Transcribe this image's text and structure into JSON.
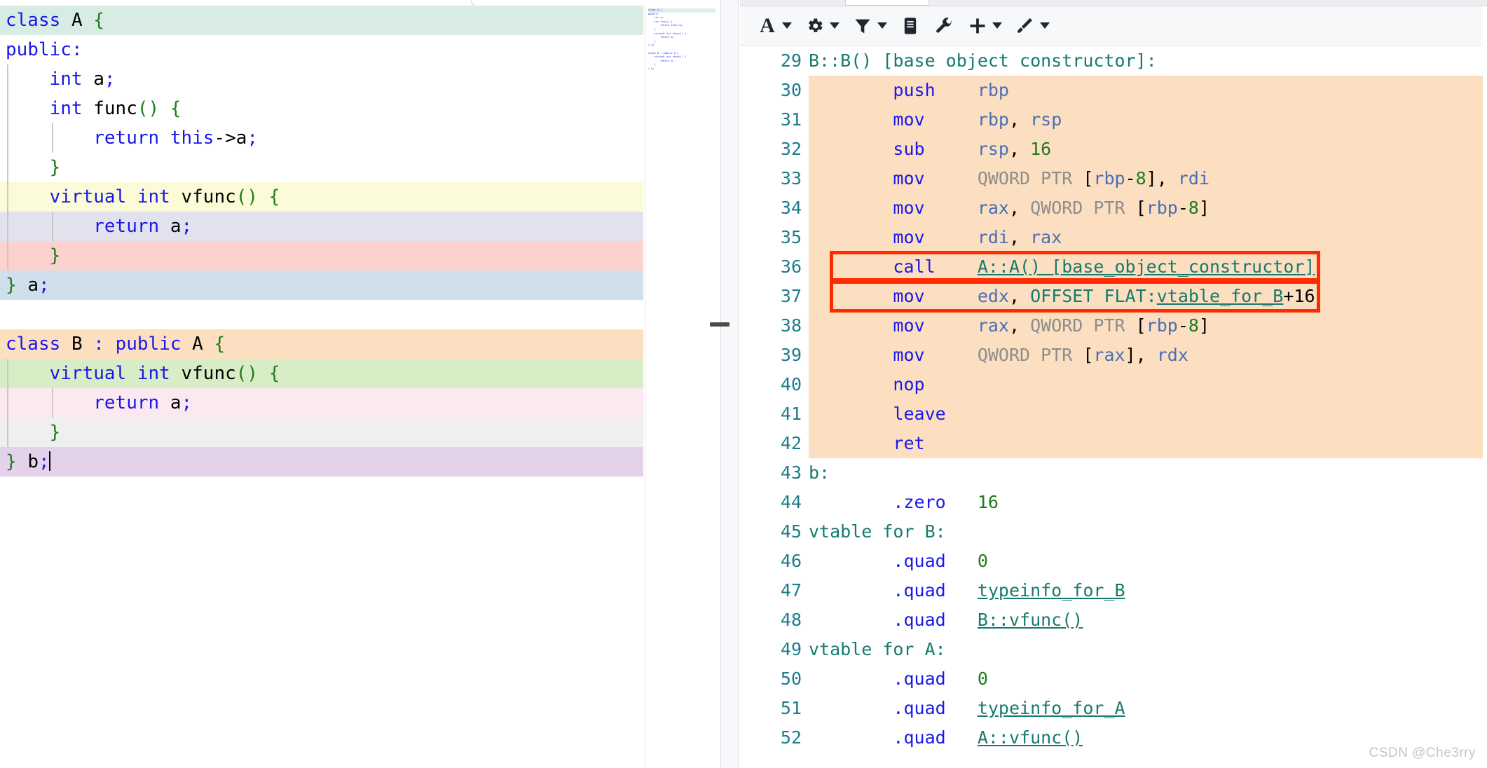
{
  "app": {
    "name": "compiler-explorer",
    "watermark": "CSDN @Che3rry"
  },
  "left_editor": {
    "language": "C++",
    "lines": [
      {
        "text": "class A {",
        "highlight": "#d8ece4"
      },
      {
        "text": "public:",
        "highlight": ""
      },
      {
        "text": "    int a;",
        "highlight": ""
      },
      {
        "text": "    int func() {",
        "highlight": ""
      },
      {
        "text": "        return this->a;",
        "highlight": ""
      },
      {
        "text": "    }",
        "highlight": ""
      },
      {
        "text": "    virtual int vfunc() {",
        "highlight": "#fbfbd7"
      },
      {
        "text": "        return a;",
        "highlight": "#e2e2ef"
      },
      {
        "text": "    }",
        "highlight": "#fbd2cd"
      },
      {
        "text": "} a;",
        "highlight": "#cfe0ec"
      },
      {
        "text": "",
        "highlight": ""
      },
      {
        "text": "class B : public A {",
        "highlight": "#fbdfc0"
      },
      {
        "text": "    virtual int vfunc() {",
        "highlight": "#d7edc6"
      },
      {
        "text": "        return a;",
        "highlight": "#fbe8f1"
      },
      {
        "text": "    }",
        "highlight": "#efefef"
      },
      {
        "text": "} b;",
        "highlight": "#e4d2ea"
      }
    ]
  },
  "asm_toolbar": {
    "items": [
      {
        "icon": "font-size-icon",
        "label": "A",
        "has_dropdown": true
      },
      {
        "icon": "gear-icon",
        "label": "",
        "has_dropdown": true
      },
      {
        "icon": "filter-icon",
        "label": "",
        "has_dropdown": true
      },
      {
        "icon": "library-icon",
        "label": "",
        "has_dropdown": false
      },
      {
        "icon": "wrench-icon",
        "label": "",
        "has_dropdown": false
      },
      {
        "icon": "plus-icon",
        "label": "",
        "has_dropdown": true
      },
      {
        "icon": "brush-icon",
        "label": "",
        "has_dropdown": true
      }
    ]
  },
  "asm_pane": {
    "highlight_color": "#fbdfc0",
    "annotation_box_color": "#ff2b00",
    "rows": [
      {
        "num": "29",
        "highlight": false,
        "parts": [
          {
            "t": "B::B() [base object constructor]:",
            "c": "a-lbl"
          }
        ]
      },
      {
        "num": "30",
        "highlight": true,
        "parts": [
          {
            "t": "        push    ",
            "c": "a-mn"
          },
          {
            "t": "rbp",
            "c": "a-reg"
          }
        ]
      },
      {
        "num": "31",
        "highlight": true,
        "parts": [
          {
            "t": "        mov     ",
            "c": "a-mn"
          },
          {
            "t": "rbp",
            "c": "a-reg"
          },
          {
            "t": ", ",
            "c": "a-pl"
          },
          {
            "t": "rsp",
            "c": "a-reg"
          }
        ]
      },
      {
        "num": "32",
        "highlight": true,
        "parts": [
          {
            "t": "        sub     ",
            "c": "a-mn"
          },
          {
            "t": "rsp",
            "c": "a-reg"
          },
          {
            "t": ", ",
            "c": "a-pl"
          },
          {
            "t": "16",
            "c": "a-num"
          }
        ]
      },
      {
        "num": "33",
        "highlight": true,
        "parts": [
          {
            "t": "        mov     ",
            "c": "a-mn"
          },
          {
            "t": "QWORD PTR ",
            "c": "a-ptr"
          },
          {
            "t": "[",
            "c": "a-pl"
          },
          {
            "t": "rbp",
            "c": "a-reg"
          },
          {
            "t": "-",
            "c": "a-pl"
          },
          {
            "t": "8",
            "c": "a-num"
          },
          {
            "t": "], ",
            "c": "a-pl"
          },
          {
            "t": "rdi",
            "c": "a-reg"
          }
        ]
      },
      {
        "num": "34",
        "highlight": true,
        "parts": [
          {
            "t": "        mov     ",
            "c": "a-mn"
          },
          {
            "t": "rax",
            "c": "a-reg"
          },
          {
            "t": ", ",
            "c": "a-pl"
          },
          {
            "t": "QWORD PTR ",
            "c": "a-ptr"
          },
          {
            "t": "[",
            "c": "a-pl"
          },
          {
            "t": "rbp",
            "c": "a-reg"
          },
          {
            "t": "-",
            "c": "a-pl"
          },
          {
            "t": "8",
            "c": "a-num"
          },
          {
            "t": "]",
            "c": "a-pl"
          }
        ]
      },
      {
        "num": "35",
        "highlight": true,
        "parts": [
          {
            "t": "        mov     ",
            "c": "a-mn"
          },
          {
            "t": "rdi",
            "c": "a-reg"
          },
          {
            "t": ", ",
            "c": "a-pl"
          },
          {
            "t": "rax",
            "c": "a-reg"
          }
        ]
      },
      {
        "num": "36",
        "highlight": true,
        "boxed": true,
        "parts": [
          {
            "t": "        call    ",
            "c": "a-mn"
          },
          {
            "t": "A::A() [base_object_constructor]",
            "c": "a-sym"
          }
        ]
      },
      {
        "num": "37",
        "highlight": true,
        "boxed": true,
        "parts": [
          {
            "t": "        mov     ",
            "c": "a-mn"
          },
          {
            "t": "edx",
            "c": "a-reg"
          },
          {
            "t": ", ",
            "c": "a-pl"
          },
          {
            "t": "OFFSET FLAT:",
            "c": "a-lbl"
          },
          {
            "t": "vtable_for_B",
            "c": "a-sym"
          },
          {
            "t": "+16",
            "c": "a-pl"
          }
        ]
      },
      {
        "num": "38",
        "highlight": true,
        "parts": [
          {
            "t": "        mov     ",
            "c": "a-mn"
          },
          {
            "t": "rax",
            "c": "a-reg"
          },
          {
            "t": ", ",
            "c": "a-pl"
          },
          {
            "t": "QWORD PTR ",
            "c": "a-ptr"
          },
          {
            "t": "[",
            "c": "a-pl"
          },
          {
            "t": "rbp",
            "c": "a-reg"
          },
          {
            "t": "-",
            "c": "a-pl"
          },
          {
            "t": "8",
            "c": "a-num"
          },
          {
            "t": "]",
            "c": "a-pl"
          }
        ]
      },
      {
        "num": "39",
        "highlight": true,
        "parts": [
          {
            "t": "        mov     ",
            "c": "a-mn"
          },
          {
            "t": "QWORD PTR ",
            "c": "a-ptr"
          },
          {
            "t": "[",
            "c": "a-pl"
          },
          {
            "t": "rax",
            "c": "a-reg"
          },
          {
            "t": "], ",
            "c": "a-pl"
          },
          {
            "t": "rdx",
            "c": "a-reg"
          }
        ]
      },
      {
        "num": "40",
        "highlight": true,
        "parts": [
          {
            "t": "        nop",
            "c": "a-mn"
          }
        ]
      },
      {
        "num": "41",
        "highlight": true,
        "parts": [
          {
            "t": "        leave",
            "c": "a-mn"
          }
        ]
      },
      {
        "num": "42",
        "highlight": true,
        "parts": [
          {
            "t": "        ret",
            "c": "a-mn"
          }
        ]
      },
      {
        "num": "43",
        "highlight": false,
        "parts": [
          {
            "t": "b:",
            "c": "a-lbl"
          }
        ]
      },
      {
        "num": "44",
        "highlight": false,
        "parts": [
          {
            "t": "        .zero   ",
            "c": "a-mn"
          },
          {
            "t": "16",
            "c": "a-num"
          }
        ]
      },
      {
        "num": "45",
        "highlight": false,
        "parts": [
          {
            "t": "vtable for B:",
            "c": "a-lbl"
          }
        ]
      },
      {
        "num": "46",
        "highlight": false,
        "parts": [
          {
            "t": "        .quad   ",
            "c": "a-mn"
          },
          {
            "t": "0",
            "c": "a-num"
          }
        ]
      },
      {
        "num": "47",
        "highlight": false,
        "parts": [
          {
            "t": "        .quad   ",
            "c": "a-mn"
          },
          {
            "t": "typeinfo_for_B",
            "c": "a-sym"
          }
        ]
      },
      {
        "num": "48",
        "highlight": false,
        "parts": [
          {
            "t": "        .quad   ",
            "c": "a-mn"
          },
          {
            "t": "B::vfunc()",
            "c": "a-sym"
          }
        ]
      },
      {
        "num": "49",
        "highlight": false,
        "parts": [
          {
            "t": "vtable for A:",
            "c": "a-lbl"
          }
        ]
      },
      {
        "num": "50",
        "highlight": false,
        "parts": [
          {
            "t": "        .quad   ",
            "c": "a-mn"
          },
          {
            "t": "0",
            "c": "a-num"
          }
        ]
      },
      {
        "num": "51",
        "highlight": false,
        "parts": [
          {
            "t": "        .quad   ",
            "c": "a-mn"
          },
          {
            "t": "typeinfo_for_A",
            "c": "a-sym"
          }
        ]
      },
      {
        "num": "52",
        "highlight": false,
        "parts": [
          {
            "t": "        .quad   ",
            "c": "a-mn"
          },
          {
            "t": "A::vfunc()",
            "c": "a-sym"
          }
        ]
      }
    ]
  },
  "minimap": {
    "lines": [
      "class A {",
      "public:",
      "    int a;",
      "    int func() {",
      "        return this->a;",
      "    }",
      "    virtual int vfunc() {",
      "        return a;",
      "    }",
      "} a;",
      "",
      "class B : public A {",
      "    virtual int vfunc() {",
      "        return a;",
      "    }",
      "} b;"
    ]
  }
}
